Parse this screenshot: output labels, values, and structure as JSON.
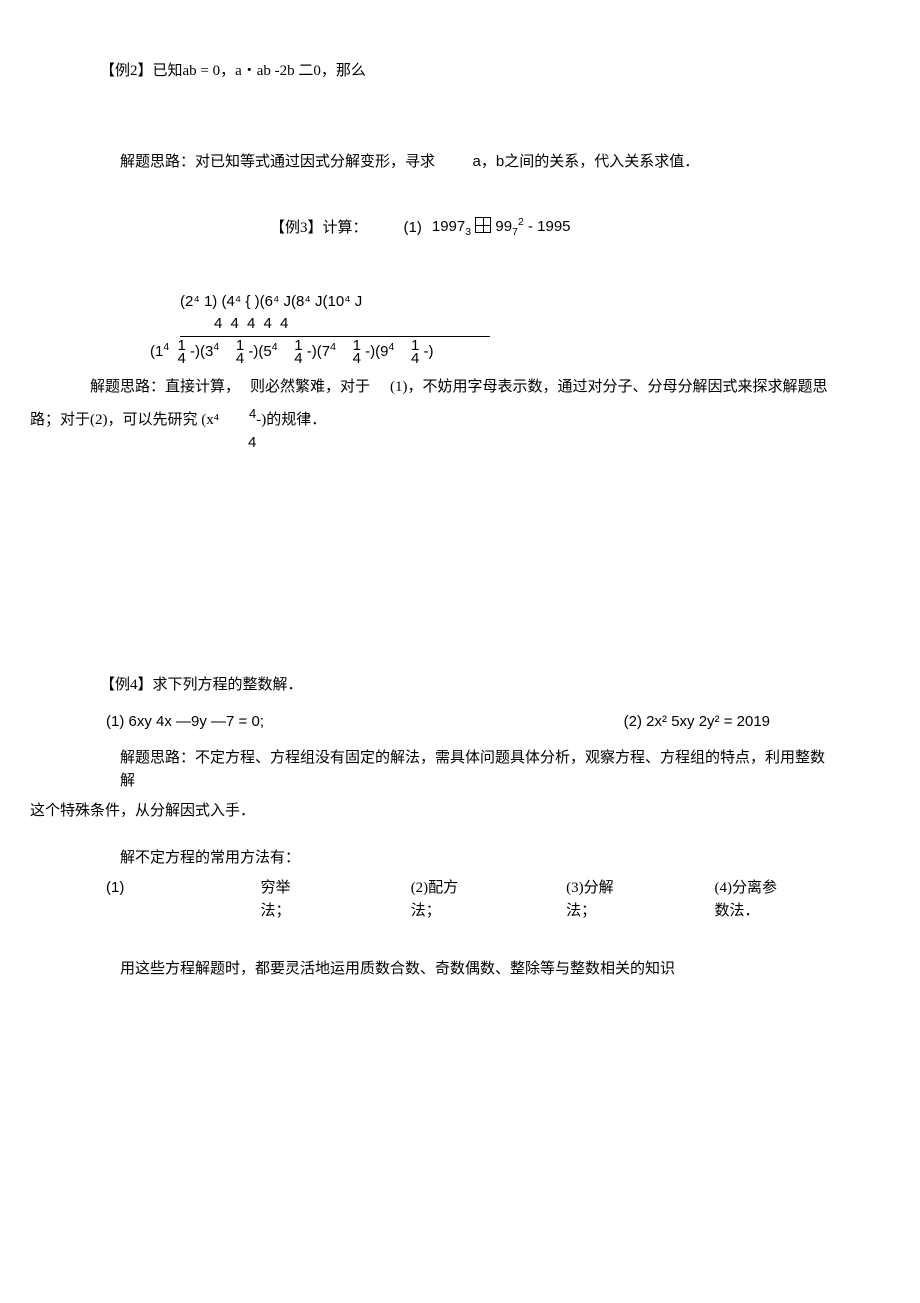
{
  "ex2": {
    "title": "【例2】已知ab = 0，a・ab -2b 二0，那么",
    "hint": "解题思路：对已知等式通过因式分解变形，寻求",
    "hint_tail": "a，b之间的关系，代入关系求值．"
  },
  "ex3": {
    "title": "【例3】计算：",
    "part1_label": "(1)",
    "part1_expr_a": "1997",
    "part1_sub_a": "3",
    "part1_expr_b": "99",
    "part1_sub_b": "7",
    "part1_sup_b": "2",
    "part1_tail": " - 1995",
    "numerator": "(2⁴  1) (4⁴ { )(6⁴ J(8⁴ J(10⁴ J",
    "num_row2": "4       4       4       4       4",
    "denominator": "(1⁴  1 )(3⁴   1 ) (5⁴   1 )(7⁴   1 )(9⁴   1 )",
    "den_row2": "        4      4      4      4      4      4",
    "hint_a": "解题思路：直接计算，",
    "hint_b": "则必然繁难，对于",
    "hint_c": "(1)，不妨用字母表示数，通过对分子、分母分解因式来探求解题思",
    "hint_d": "路；对于(2)，可以先研究 (x⁴",
    "hint_e": "-)的规律．"
  },
  "ex4": {
    "title": "【例4】求下列方程的整数解．",
    "eq1_label": "(1)",
    "eq1": " 6xy 4x —9y —7 = 0;",
    "eq2_label": "(2)",
    "eq2": " 2x² 5xy 2y² = 2019",
    "hint1": "解题思路：不定方程、方程组没有固定的解法，需具体问题具体分析，观察方程、方程组的特点，利用整数解",
    "hint2": "这个特殊条件，从分解因式入手．",
    "hint3": "解不定方程的常用方法有：",
    "m1": "(1)",
    "m1t": "穷举法；",
    "m2": "(2)配方法；",
    "m3": "(3)分解法；",
    "m4": "(4)分离参数法．",
    "tail": "用这些方程解题时，都要灵活地运用质数合数、奇数偶数、整除等与整数相关的知识"
  }
}
